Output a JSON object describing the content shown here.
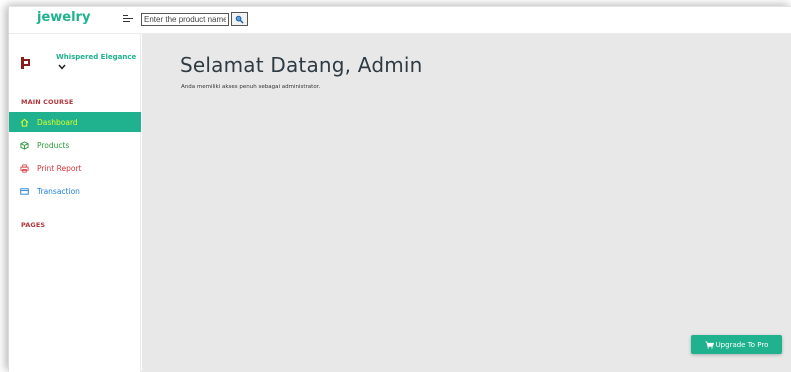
{
  "app": {
    "brand": "jewelry"
  },
  "search": {
    "placeholder": "Enter the product name"
  },
  "profile": {
    "name": "Whispered Elegance"
  },
  "sidebar": {
    "section_main": "MAIN COURSE",
    "items": [
      {
        "label": "Dashboard",
        "icon": "home-icon",
        "active": true,
        "color": "#d9ff2e"
      },
      {
        "label": "Products",
        "icon": "box-icon",
        "active": false,
        "color": "#2a9a3a"
      },
      {
        "label": "Print Report",
        "icon": "printer-icon",
        "active": false,
        "color": "#d9343b"
      },
      {
        "label": "Transaction",
        "icon": "card-icon",
        "active": false,
        "color": "#1e7fd8"
      }
    ],
    "section_pages": "PAGES"
  },
  "main": {
    "title": "Selamat Datang, Admin",
    "subtitle": "Anda memiliki akses penuh sebagai administrator."
  },
  "upgrade": {
    "label": "Upgrade To Pro"
  },
  "colors": {
    "accent": "#20b28e",
    "section": "#b0353c",
    "main_bg": "#e8e8e8"
  }
}
